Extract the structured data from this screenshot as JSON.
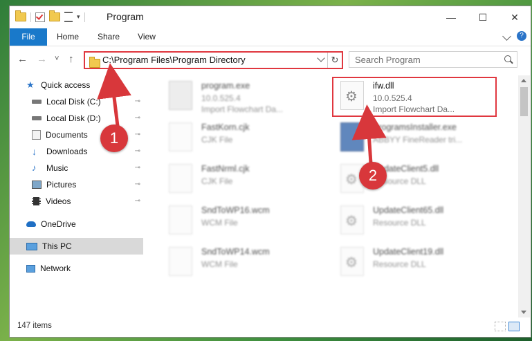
{
  "window": {
    "title": "Program",
    "controls": {
      "minimize": "—",
      "maximize": "☐",
      "close": "✕"
    }
  },
  "ribbon": {
    "tabs": [
      "File",
      "Home",
      "Share",
      "View"
    ],
    "help": "?"
  },
  "nav": {
    "back": "←",
    "forward": "→",
    "recent": "˅",
    "up": "↑",
    "address": "C:\\Program Files\\Program Directory",
    "refresh": "↻",
    "search_placeholder": "Search Program"
  },
  "sidebar": {
    "items": [
      {
        "label": "Quick access",
        "icon": "star-icon",
        "pinned": false
      },
      {
        "label": "Local Disk (C:)",
        "icon": "drive-icon",
        "pinned": true
      },
      {
        "label": "Local Disk (D:)",
        "icon": "drive-icon",
        "pinned": true
      },
      {
        "label": "Documents",
        "icon": "documents-icon",
        "pinned": true
      },
      {
        "label": "Downloads",
        "icon": "download-icon",
        "pinned": true
      },
      {
        "label": "Music",
        "icon": "music-icon",
        "pinned": true
      },
      {
        "label": "Pictures",
        "icon": "pictures-icon",
        "pinned": true
      },
      {
        "label": "Videos",
        "icon": "videos-icon",
        "pinned": true
      },
      {
        "label": "OneDrive",
        "icon": "cloud-icon",
        "pinned": false
      },
      {
        "label": "This PC",
        "icon": "computer-icon",
        "pinned": false,
        "selected": true
      },
      {
        "label": "Network",
        "icon": "network-icon",
        "pinned": false
      }
    ],
    "pin_glyph": "📌"
  },
  "files": [
    {
      "name": "program.exe",
      "line1": "10.0.525.4",
      "line2": "Import Flowchart Da...",
      "icon": "exe-icon",
      "blurred": true
    },
    {
      "name": "ifw.dll",
      "line1": "10.0.525.4",
      "line2": "Import Flowchart Da...",
      "icon": "dll-gear-icon",
      "blurred": false,
      "highlighted": true
    },
    {
      "name": "FastKorn.cjk",
      "line1": "CJK File",
      "line2": "",
      "icon": "blank-file-icon",
      "blurred": true
    },
    {
      "name": "ProgramsInstaller.exe",
      "line1": "ABBYY FineReader tri...",
      "line2": "",
      "icon": "installer-icon",
      "blurred": true
    },
    {
      "name": "FastNrml.cjk",
      "line1": "CJK File",
      "line2": "",
      "icon": "blank-file-icon",
      "blurred": true
    },
    {
      "name": "UpdateClient5.dll",
      "line1": "Resource DLL",
      "line2": "",
      "icon": "dll-gear-icon",
      "blurred": true
    },
    {
      "name": "SndToWP16.wcm",
      "line1": "WCM File",
      "line2": "",
      "icon": "blank-file-icon",
      "blurred": true
    },
    {
      "name": "UpdateClient65.dll",
      "line1": "Resource DLL",
      "line2": "",
      "icon": "dll-gear-icon",
      "blurred": true
    },
    {
      "name": "SndToWP14.wcm",
      "line1": "WCM File",
      "line2": "",
      "icon": "blank-file-icon",
      "blurred": true
    },
    {
      "name": "UpdateClient19.dll",
      "line1": "Resource DLL",
      "line2": "",
      "icon": "dll-gear-icon",
      "blurred": true
    }
  ],
  "status": {
    "items_count": "147 items"
  },
  "callouts": [
    "1",
    "2"
  ],
  "colors": {
    "accent": "#1979ca",
    "highlight": "#e0373f",
    "callout": "#d8373b"
  }
}
